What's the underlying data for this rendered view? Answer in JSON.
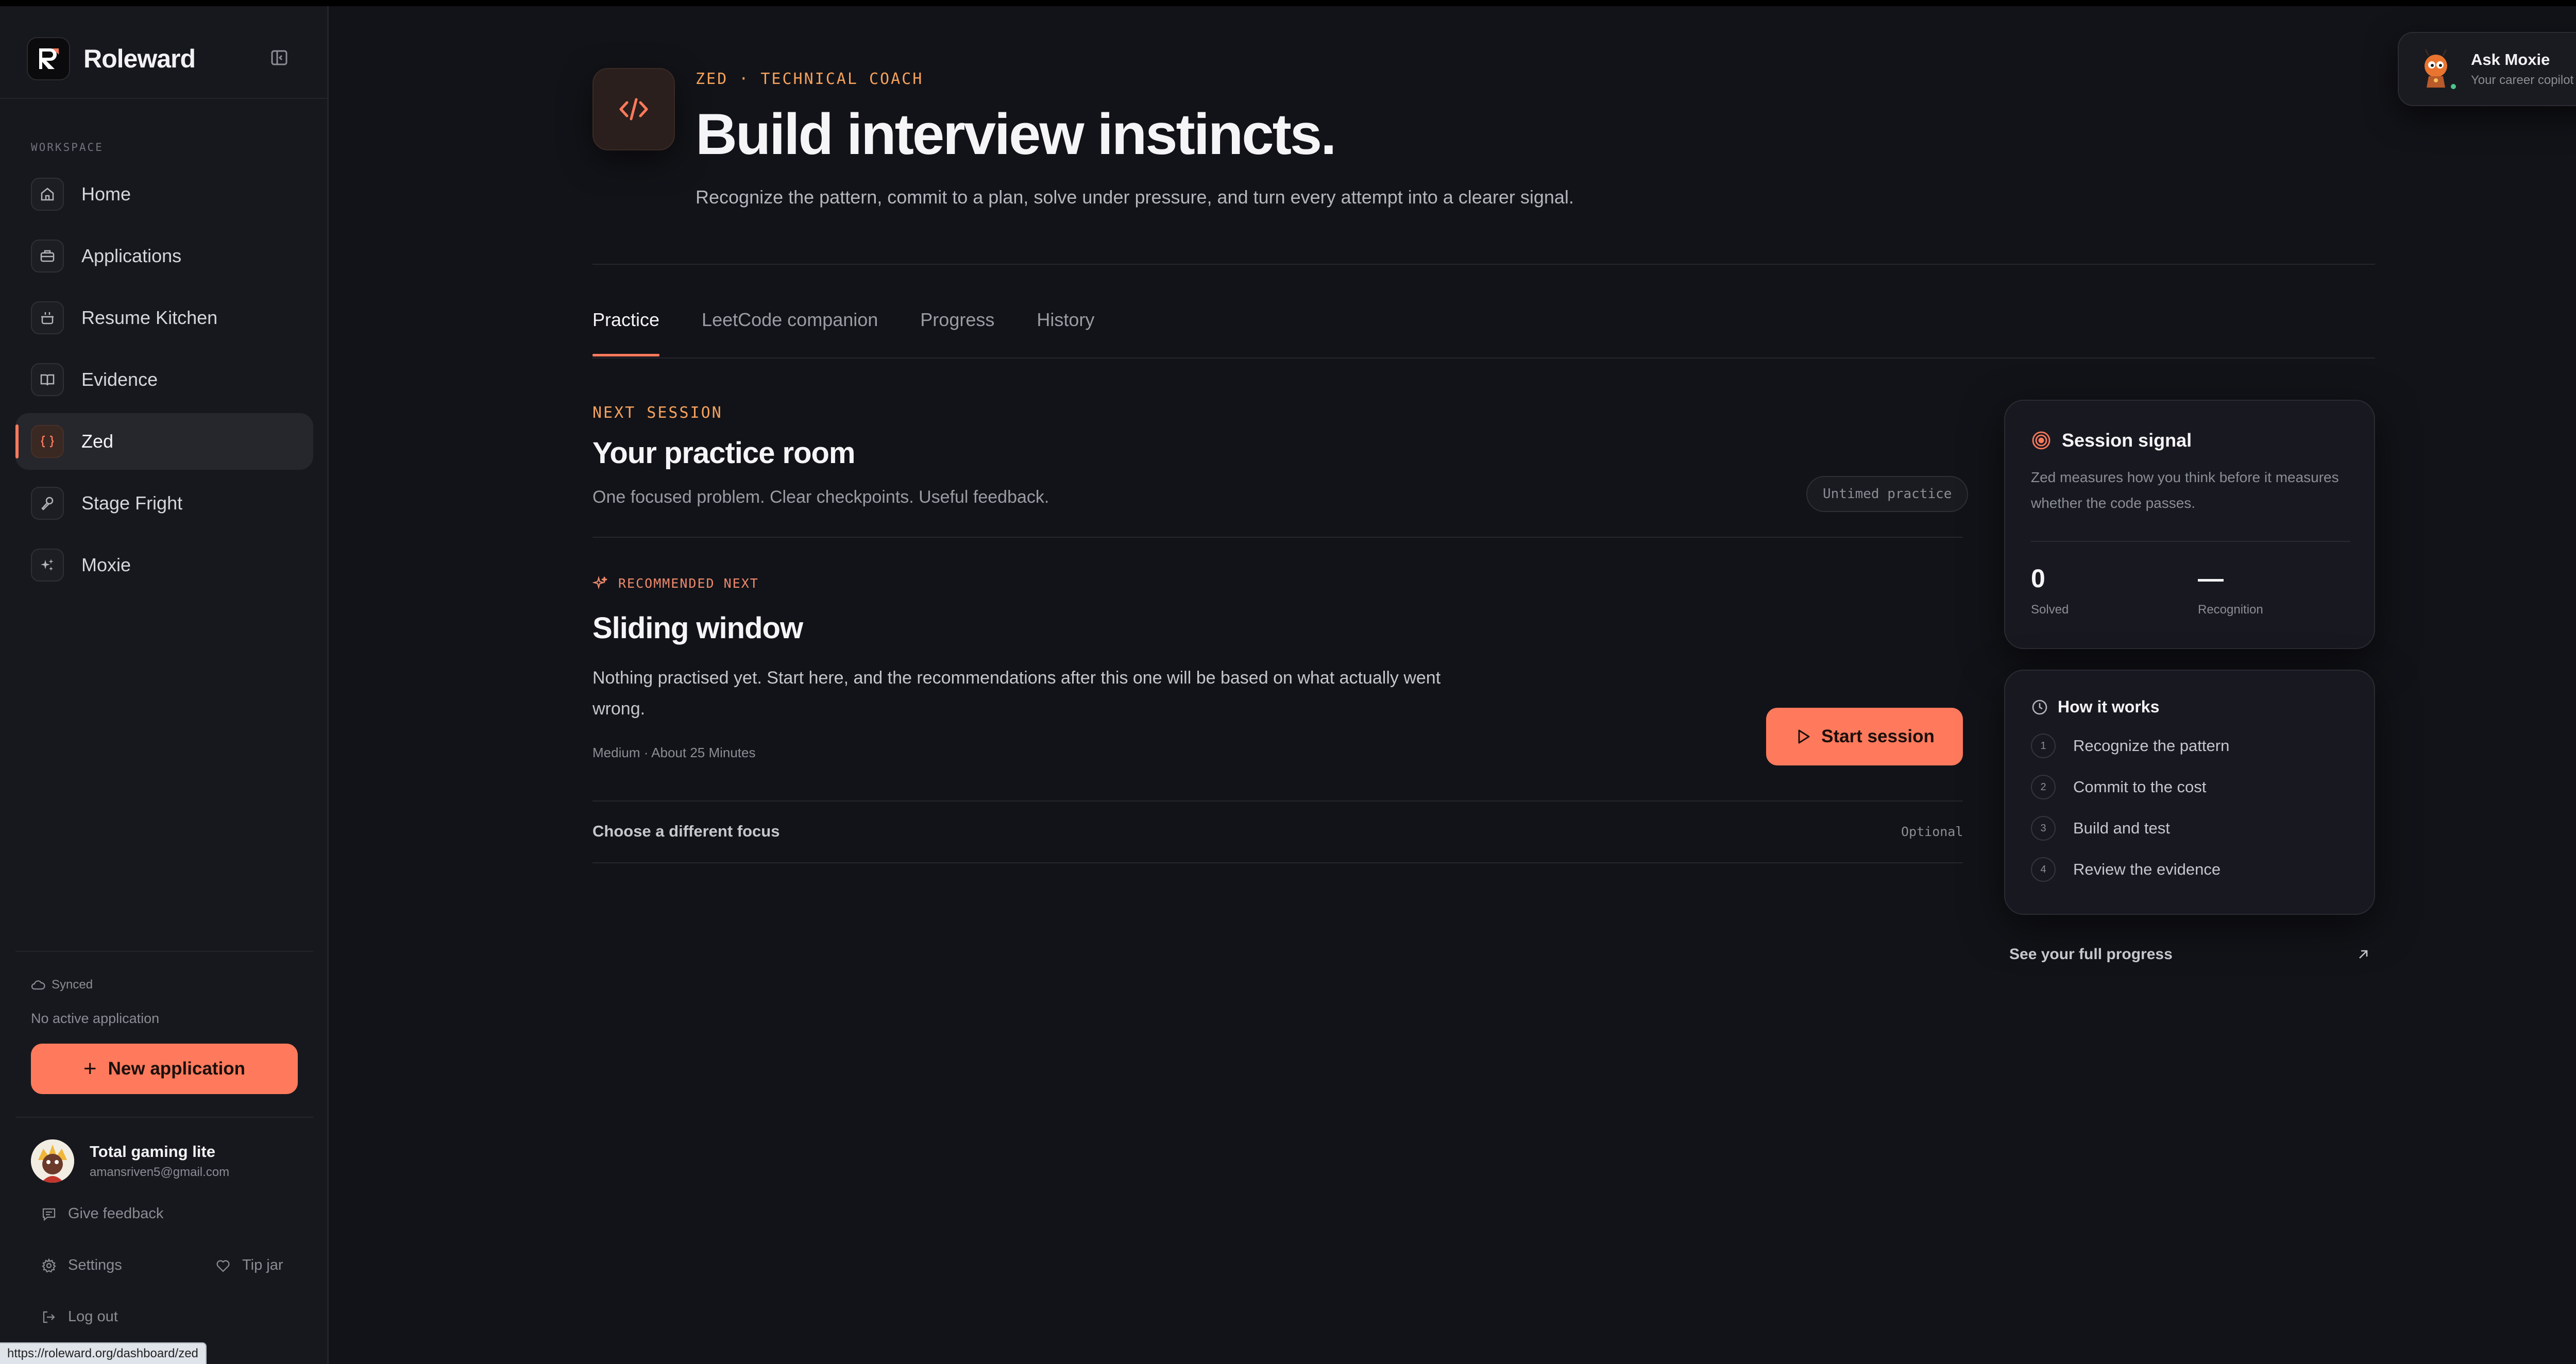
{
  "app": {
    "name": "Roleward",
    "status_url": "https://roleward.org/dashboard/zed"
  },
  "sidebar": {
    "section_label": "WORKSPACE",
    "items": [
      {
        "label": "Home",
        "icon": "home-icon"
      },
      {
        "label": "Applications",
        "icon": "briefcase-icon"
      },
      {
        "label": "Resume Kitchen",
        "icon": "cooking-pot-icon"
      },
      {
        "label": "Evidence",
        "icon": "open-book-icon"
      },
      {
        "label": "Zed",
        "icon": "braces-icon",
        "active": true
      },
      {
        "label": "Stage Fright",
        "icon": "microphone-icon"
      },
      {
        "label": "Moxie",
        "icon": "sparkles-icon"
      }
    ],
    "sync_status": "Synced",
    "no_active": "No active application",
    "new_application": "New application",
    "user": {
      "name": "Total gaming lite",
      "email": "amansriven5@gmail.com"
    },
    "give_feedback": "Give feedback",
    "settings": "Settings",
    "tip_jar": "Tip jar",
    "log_out": "Log out"
  },
  "header": {
    "eyebrow": "ZED · TECHNICAL COACH",
    "title": "Build interview instincts.",
    "subtitle": "Recognize the pattern, commit to a plan, solve under pressure, and turn every attempt into a clearer signal."
  },
  "ask_moxie": {
    "title": "Ask Moxie",
    "subtitle": "Your career copilot"
  },
  "tabs": [
    {
      "label": "Practice",
      "active": true
    },
    {
      "label": "LeetCode companion"
    },
    {
      "label": "Progress"
    },
    {
      "label": "History"
    }
  ],
  "session": {
    "eyebrow": "NEXT SESSION",
    "title": "Your practice room",
    "subtitle": "One focused problem. Clear checkpoints. Useful feedback.",
    "mode_badge": "Untimed practice",
    "recommended_label": "RECOMMENDED NEXT",
    "focus_title": "Sliding window",
    "focus_desc": "Nothing practised yet. Start here, and the recommendations after this one will be based on what actually went wrong.",
    "meta": "Medium · About 25 Minutes",
    "start_button": "Start session",
    "choose_focus": "Choose a different focus",
    "choose_tag": "Optional"
  },
  "signal": {
    "title": "Session signal",
    "description": "Zed measures how you think before it measures whether the code passes.",
    "stats": [
      {
        "value": "0",
        "label": "Solved"
      },
      {
        "value": "—",
        "label": "Recognition"
      }
    ]
  },
  "how_it_works": {
    "title": "How it works",
    "steps": [
      {
        "num": "1",
        "label": "Recognize the pattern"
      },
      {
        "num": "2",
        "label": "Commit to the cost"
      },
      {
        "num": "3",
        "label": "Build and test"
      },
      {
        "num": "4",
        "label": "Review the evidence"
      }
    ]
  },
  "full_progress_link": "See your full progress",
  "colors": {
    "accent": "#ff7a5c",
    "eyebrow": "#f6a25d",
    "background": "#121318",
    "sidebar": "#17181d"
  }
}
